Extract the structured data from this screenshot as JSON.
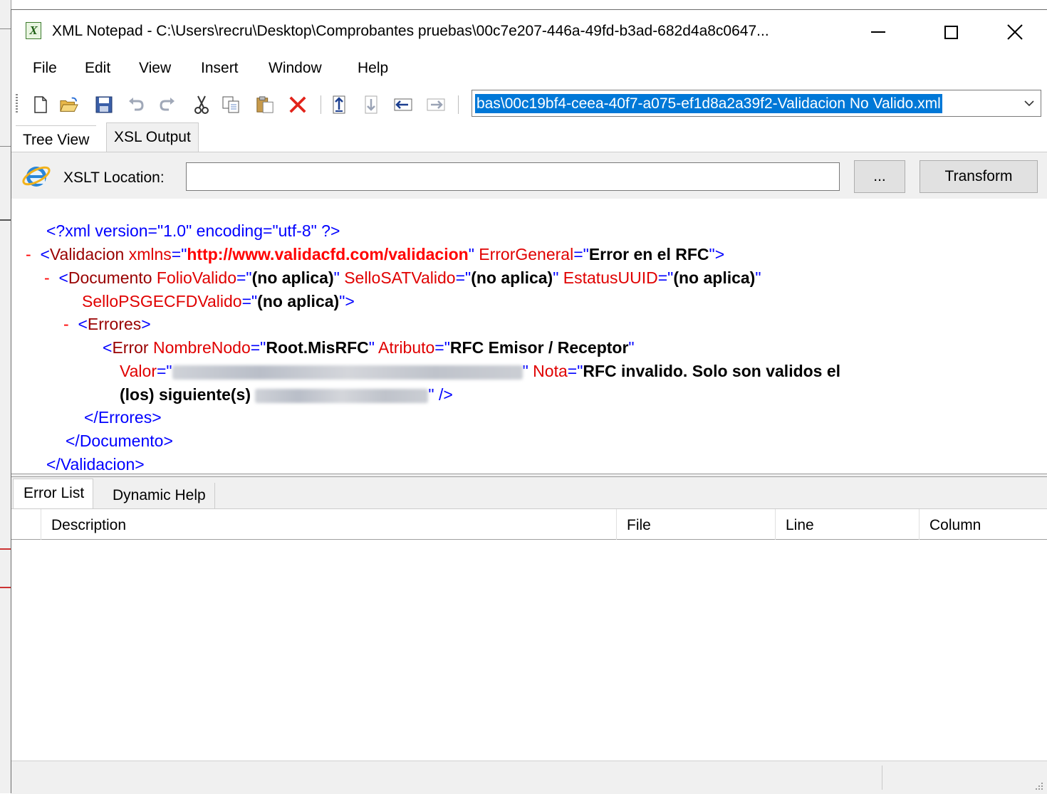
{
  "window": {
    "title": "XML Notepad - C:\\Users\\recru\\Desktop\\Comprobantes pruebas\\00c7e207-446a-49fd-b3ad-682d4a8c0647...",
    "app_icon_glyph": "X"
  },
  "menu": [
    "File",
    "Edit",
    "View",
    "Insert",
    "Window",
    "Help"
  ],
  "toolbar": {
    "path": "bas\\00c19bf4-ceea-40f7-a075-ef1d8a2a39f2-Validacion No Valido.xml",
    "icons": [
      "new-icon",
      "open-icon",
      "save-icon",
      "undo-icon",
      "redo-icon",
      "cut-icon",
      "copy-icon",
      "paste-icon",
      "delete-icon",
      "nudge-up-icon",
      "nudge-down-icon",
      "nudge-left-icon",
      "nudge-right-icon"
    ]
  },
  "top_tabs": {
    "tree_view": "Tree View",
    "xsl_output": "XSL Output"
  },
  "xslt": {
    "label": "XSLT Location:",
    "value": "",
    "browse": "...",
    "transform": "Transform"
  },
  "xml": {
    "pi": "<?xml version=\"1.0\" encoding=\"utf-8\" ?>",
    "minus": "-",
    "eq": "=\"",
    "q": "\"",
    "lt": "<",
    "gt": ">",
    "selfclose": " />",
    "validacion_tag": "Validacion",
    "xmlns_attr": "xmlns",
    "xmlns_val": "http://www.validacfd.com/validacion",
    "errorgeneral_attr": "ErrorGeneral",
    "errorgeneral_val": "Error en el RFC",
    "documento_tag": "Documento",
    "foliovalido_attr": "FolioValido",
    "sellosatvalido_attr": "SelloSATValido",
    "estatusuuid_attr": "EstatusUUID",
    "sellopsgecfdvalido_attr": "SelloPSGECFDValido",
    "no_aplica": "(no aplica)",
    "errores_tag": "Errores",
    "error_tag": "Error",
    "nombrenodo_attr": "NombreNodo",
    "nombrenodo_val": "Root.MisRFC",
    "atributo_attr": "Atributo",
    "atributo_val": "RFC Emisor / Receptor",
    "valor_attr": "Valor",
    "nota_attr": "Nota",
    "nota_val_1": "RFC invalido. Solo son validos el",
    "nota_val_2": "(los) siguiente(s) ",
    "close_errores": "</Errores>",
    "close_documento": "</Documento>",
    "close_validacion": "</Validacion>"
  },
  "bottom_tabs": {
    "error_list": "Error List",
    "dynamic_help": "Dynamic Help"
  },
  "error_columns": [
    "Description",
    "File",
    "Line",
    "Column"
  ]
}
